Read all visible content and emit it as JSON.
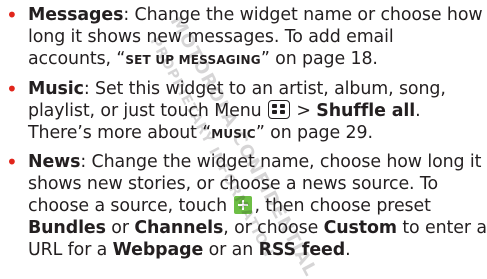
{
  "bullet_color": "#e1251b",
  "green_key_color": "#6dbe45",
  "watermark": {
    "lines": [
      "MOTOROLA CONFIDENTIAL",
      "PROPRIETARY INFORMATION"
    ]
  },
  "items": [
    {
      "title": "Messages",
      "lines": [
        ": Change the widget name or choose how",
        "long it shows new messages. To add email",
        "accounts, “",
        "SET UP MESSAGING",
        "” on page 18."
      ]
    },
    {
      "title": "Music",
      "lines": [
        ": Set this widget to an artist, album, song,",
        "playlist, or just touch Menu ",
        " > ",
        "Shuffle all",
        ".",
        "There’s more about “",
        "MUSIC",
        "” on page 29."
      ],
      "menu_icon": "menu-grid-icon"
    },
    {
      "title": "News",
      "lines": [
        ": Change the widget name, choose how long it",
        "shows new stories, or choose a news source. To",
        "choose a source, touch ",
        ", then choose preset",
        "Bundles",
        " or ",
        "Channels",
        ", or choose ",
        "Custom",
        " to enter a",
        "URL for a ",
        "Webpage",
        " or an ",
        "RSS feed",
        "."
      ],
      "plus_icon": "plus-icon"
    }
  ]
}
